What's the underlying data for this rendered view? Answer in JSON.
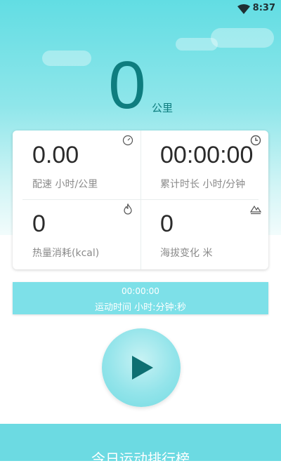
{
  "status_bar": {
    "time": "8:37",
    "icon": "wifi-icon"
  },
  "distance": {
    "value": "0",
    "unit": "公里"
  },
  "stats": [
    {
      "value": "0.00",
      "label": "配速  小时/公里",
      "icon": "speedometer-icon"
    },
    {
      "value": "00:00:00",
      "label": "累计时长  小时/分钟",
      "icon": "clock-icon"
    },
    {
      "value": "0",
      "label": "热量消耗(kcal)",
      "icon": "flame-icon"
    },
    {
      "value": "0",
      "label": "海拔变化 米",
      "icon": "mountain-icon"
    }
  ],
  "run_timer": {
    "time": "00:00:00",
    "label": "运动时间 小时:分钟:秒"
  },
  "play_button": {
    "icon": "play-icon"
  },
  "bottom_tab": {
    "label": "今日运动排行榜"
  },
  "colors": {
    "accent": "#0e7d7f",
    "primary": "#6cdae2"
  }
}
